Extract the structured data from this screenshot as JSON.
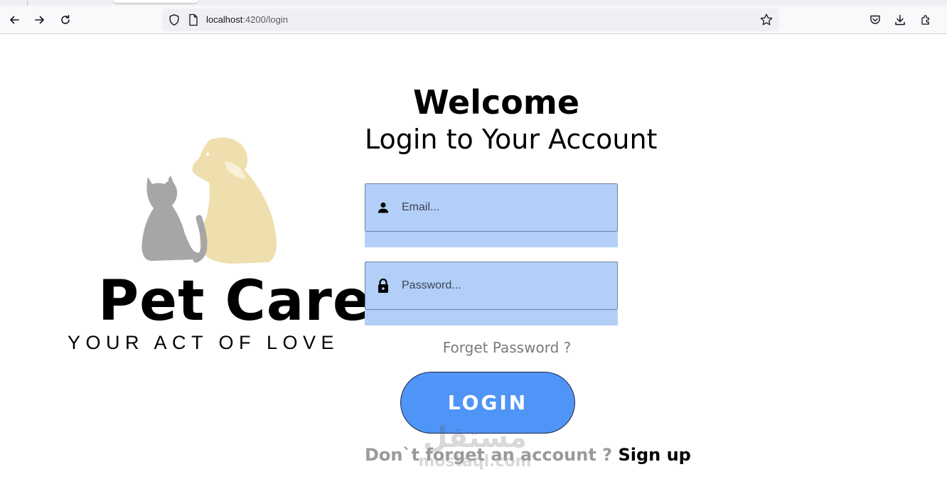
{
  "browser": {
    "url_host": "localhost",
    "url_rest": ":4200/login",
    "icons": [
      "back-icon",
      "forward-icon",
      "reload-icon",
      "shield-icon",
      "page-icon",
      "bookmark-star-icon",
      "pocket-icon",
      "download-icon",
      "extensions-icon"
    ]
  },
  "brand": {
    "name": "Pet Care",
    "tagline": "YOUR ACT OF LOVE",
    "colors": {
      "cat": "#a6a6a6",
      "dog": "#efdfae"
    }
  },
  "header": {
    "welcome": "Welcome",
    "subtitle": "Login to Your Account"
  },
  "form": {
    "email_placeholder": "Email...",
    "password_placeholder": "Password...",
    "forget_password": "Forget Password ?",
    "login_label": "LOGIN",
    "signup_prompt": "Don`t forget an account ?",
    "signup_link": "Sign up"
  },
  "watermark": {
    "line1": "مستقل",
    "line2": "mostaql.com"
  },
  "colors": {
    "field_bg": "#b3cff8",
    "button_bg": "#4f94f7",
    "muted_text": "#9a9a9a"
  }
}
